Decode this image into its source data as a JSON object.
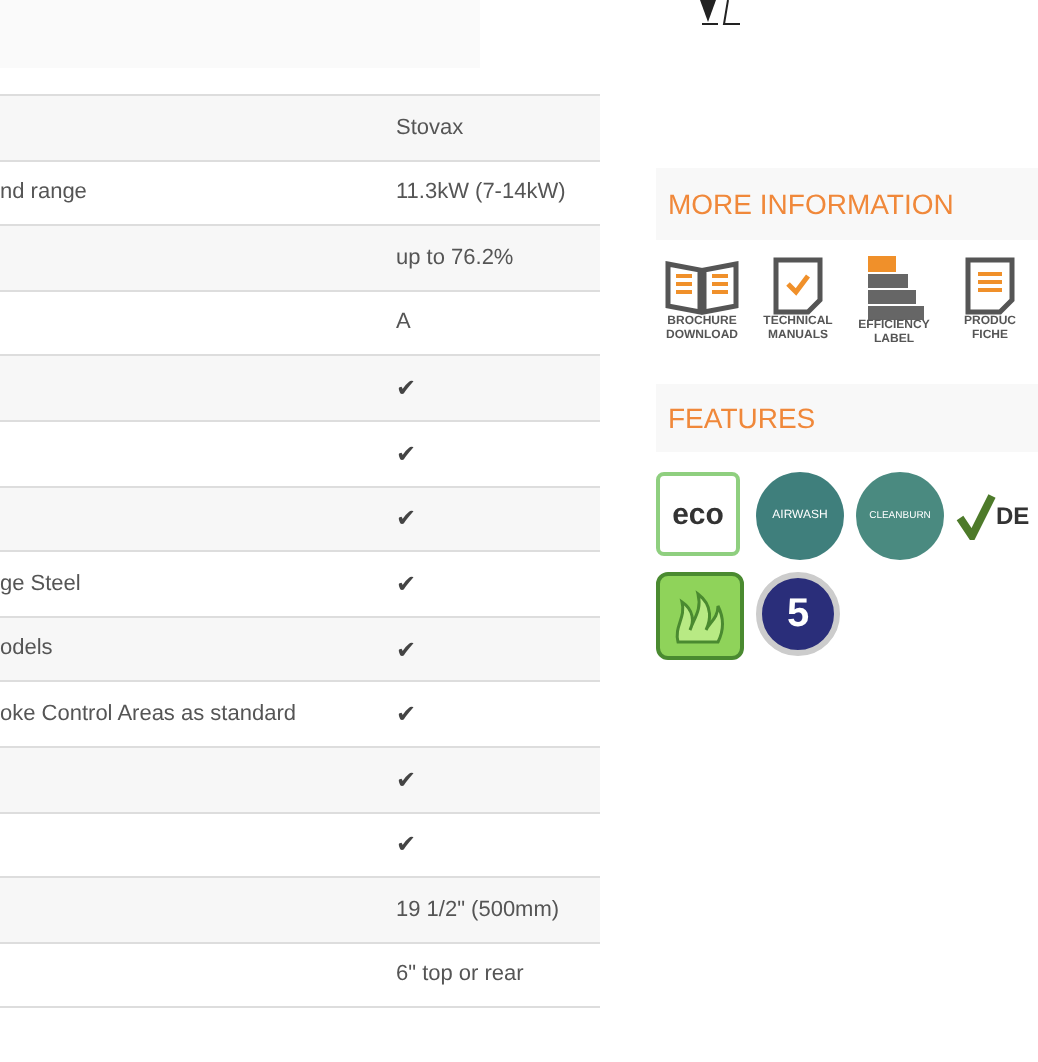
{
  "specs": [
    {
      "kind": "text",
      "value": "Stovax"
    },
    {
      "label": "nd range",
      "kind": "text",
      "value": "11.3kW (7-14kW)"
    },
    {
      "kind": "text",
      "value": "up to 76.2%"
    },
    {
      "kind": "text",
      "value": "A"
    },
    {
      "kind": "check",
      "value": "✔"
    },
    {
      "kind": "check",
      "value": "✔"
    },
    {
      "kind": "check",
      "value": "✔"
    },
    {
      "label": "ge Steel",
      "kind": "check",
      "value": "✔"
    },
    {
      "label": "odels",
      "kind": "check",
      "value": "✔"
    },
    {
      "label": "oke Control Areas as standard",
      "kind": "check",
      "value": "✔"
    },
    {
      "kind": "check",
      "value": "✔"
    },
    {
      "kind": "check",
      "value": "✔"
    },
    {
      "kind": "text",
      "value": "19 1/2\" (500mm)"
    },
    {
      "kind": "text",
      "value": "6\" top or rear"
    }
  ],
  "more_information": {
    "title": "MORE INFORMATION",
    "links": [
      {
        "kind": "brochure",
        "lines": [
          "BROCHURE",
          "DOWNLOAD"
        ]
      },
      {
        "kind": "manual",
        "lines": [
          "TECHNICAL",
          "MANUALS"
        ]
      },
      {
        "kind": "efficiency",
        "lines": [
          "EFFICIENCY",
          "LABEL"
        ]
      },
      {
        "kind": "fiche",
        "lines": [
          "PRODUC",
          "FICHE"
        ]
      }
    ]
  },
  "features": {
    "title": "FEATURES",
    "badges": [
      {
        "kind": "eco",
        "text": "eco"
      },
      {
        "kind": "airwash",
        "text": "AIRWASH"
      },
      {
        "kind": "cleanburn",
        "text": "CLEANBURN"
      },
      {
        "kind": "defra",
        "text": "DE"
      },
      {
        "kind": "flames"
      },
      {
        "kind": "warranty",
        "text": "5"
      }
    ]
  }
}
